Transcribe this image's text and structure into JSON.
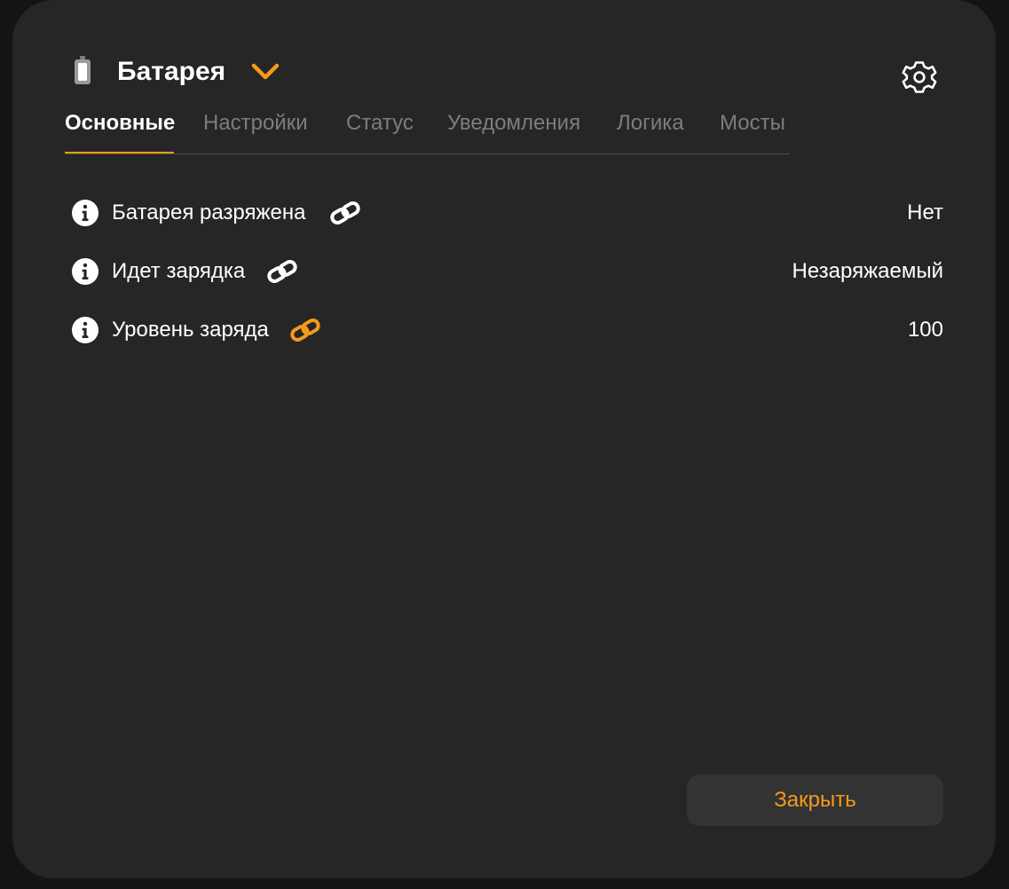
{
  "device": {
    "icon": "battery-icon",
    "title": "Батарея",
    "dropdown_icon": "chevron-down-icon",
    "settings_icon": "gear-icon"
  },
  "tabs": [
    {
      "label": "Основные",
      "active": true
    },
    {
      "label": "Настройки",
      "active": false
    },
    {
      "label": "Статус",
      "active": false
    },
    {
      "label": "Уведомления",
      "active": false
    },
    {
      "label": "Логика",
      "active": false
    },
    {
      "label": "Мосты",
      "active": false
    }
  ],
  "properties": [
    {
      "label": "Батарея разряжена",
      "value": "Нет",
      "info_icon": "info-icon",
      "link_icon": "link-icon",
      "link_color": "#ffffff"
    },
    {
      "label": "Идет зарядка",
      "value": "Незаряжаемый",
      "info_icon": "info-icon",
      "link_icon": "link-icon",
      "link_color": "#ffffff"
    },
    {
      "label": "Уровень заряда",
      "value": "100",
      "info_icon": "info-icon",
      "link_icon": "link-icon",
      "link_color": "#f59a1a"
    }
  ],
  "footer": {
    "close_label": "Закрыть"
  },
  "colors": {
    "accent": "#f59a1a",
    "dialog_background": "#262626",
    "page_background": "#141414",
    "inactive_tab": "#7d7d7d"
  }
}
